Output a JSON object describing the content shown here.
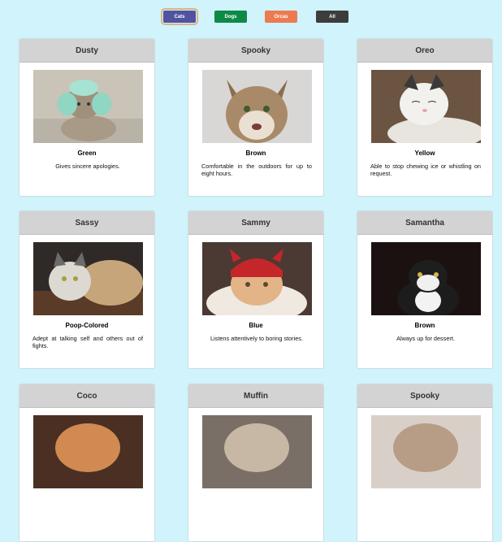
{
  "filters": [
    {
      "label": "Cats",
      "color": "#5152a0",
      "active": true
    },
    {
      "label": "Dogs",
      "color": "#0e8a48",
      "active": false
    },
    {
      "label": "Orcas",
      "color": "#ec7b52",
      "active": false
    },
    {
      "label": "All",
      "color": "#3d3d3d",
      "active": false
    }
  ],
  "cards": [
    {
      "name": "Dusty",
      "color": "Green",
      "description": "Gives sincere apologies.",
      "type": "Cat"
    },
    {
      "name": "Spooky",
      "color": "Brown",
      "description": "Comfortable in the outdoors for up to eight hours.",
      "type": "Cat"
    },
    {
      "name": "Oreo",
      "color": "Yellow",
      "description": "Able to stop chewing ice or whistling on request.",
      "type": "Cat"
    },
    {
      "name": "Sassy",
      "color": "Poop-Colored",
      "description": "Adept at talking self and others out of fights.",
      "type": "Cat"
    },
    {
      "name": "Sammy",
      "color": "Blue",
      "description": "Listens attentively to boring stories.",
      "type": "Cat"
    },
    {
      "name": "Samantha",
      "color": "Brown",
      "description": "Always up for dessert.",
      "type": "Cat"
    },
    {
      "name": "Coco",
      "color": "",
      "description": "",
      "type": "Cat"
    },
    {
      "name": "Muffin",
      "color": "",
      "description": "",
      "type": "Cat"
    },
    {
      "name": "Spooky",
      "color": "",
      "description": "",
      "type": "Cat"
    }
  ]
}
